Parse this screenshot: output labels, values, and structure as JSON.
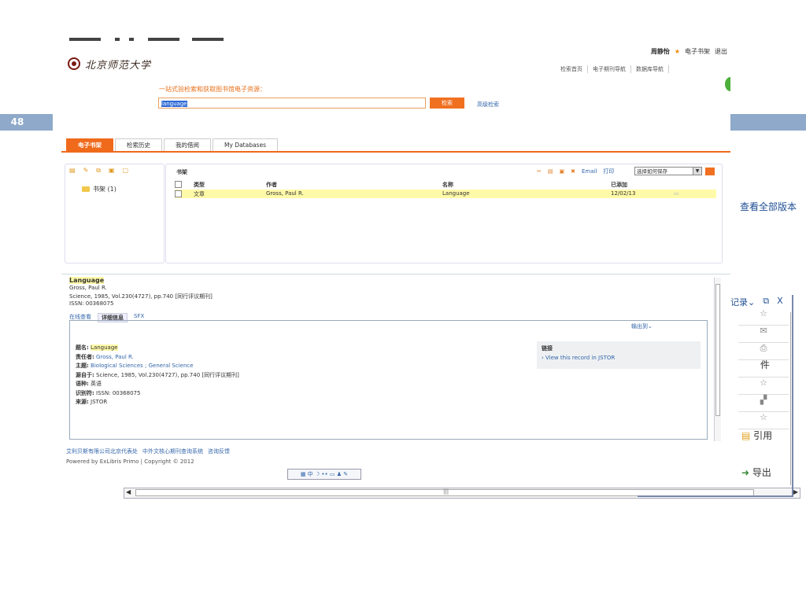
{
  "slide": {
    "page_number": "48"
  },
  "header": {
    "logo_text": "北京师范大学",
    "user_name": "周静怡",
    "eshelf_link": "电子书架",
    "logout": "退出",
    "nav_links": [
      "检索首页",
      "电子期刊导航",
      "数据库导航"
    ]
  },
  "search": {
    "slogan": "一站式验检索和获取图书馆电子资源：",
    "query": "language",
    "button": "检索",
    "advanced": "高级检索"
  },
  "tabs": [
    "电子书架",
    "检索历史",
    "我的借阅",
    "My Databases"
  ],
  "shelf": {
    "folder": "书架 (1)",
    "header": "书架",
    "email": "Email",
    "print": "打印",
    "save_option": "选择如何保存",
    "columns": [
      "类型",
      "作者",
      "名称",
      "已添加"
    ],
    "rows": [
      {
        "type": "文章",
        "author": "Gross, Paul R.",
        "title": "Language",
        "added": "12/02/13"
      }
    ]
  },
  "details": {
    "title": "Language",
    "author": "Gross, Paul R.",
    "source": "Science, 1985, Vol.230(4727), pp.740 [同行评议期刊]",
    "issn": "ISSN: 00368075",
    "tabs": [
      "在线查看",
      "详细信息",
      "SFX"
    ],
    "export": "输出到",
    "fields": {
      "title_label": "题名:",
      "title_value": "Language",
      "author_label": "责任者:",
      "author_value": "Gross, Paul R.",
      "subject_label": "主题:",
      "subject_value": "Biological Sciences ; General Science",
      "source_label": "源自于:",
      "source_value": "Science, 1985, Vol.230(4727), pp.740 [同行评议期刊]",
      "lang_label": "语种:",
      "lang_value": "英语",
      "id_label": "识别符:",
      "id_value": "ISSN: 00368075",
      "from_label": "来源:",
      "from_value": "JSTOR"
    },
    "links_head": "链接",
    "jstor_link": "View this record in JSTOR"
  },
  "footer": {
    "links": [
      "艾利贝斯有限公司北京代表处",
      "中外文核心期刊查询系统",
      "咨询反馈"
    ],
    "powered": "Powered by ExLibris Primo",
    "copyright": "Copyright © 2012",
    "ime": "中"
  },
  "overlay": {
    "view_all": "查看全部版本",
    "record_menu": "记录",
    "file_text": "件",
    "cite": "引用",
    "export": "导出"
  }
}
